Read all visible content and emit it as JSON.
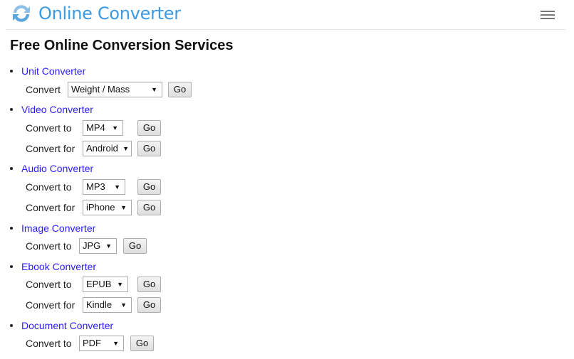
{
  "header": {
    "brand": "Online Converter",
    "menu_icon": "hamburger-icon",
    "logo_icon": "refresh-arrows-icon"
  },
  "page_title": "Free Online Conversion Services",
  "colors": {
    "brand": "#3b9ae1",
    "link": "#2a1cff"
  },
  "services": [
    {
      "label": "Unit Converter",
      "rows": [
        {
          "label": "Convert",
          "value": "Weight / Mass",
          "button": "Go"
        }
      ]
    },
    {
      "label": "Video Converter",
      "rows": [
        {
          "label": "Convert to",
          "value": "MP4",
          "button": "Go"
        },
        {
          "label": "Convert for",
          "value": "Android",
          "button": "Go"
        }
      ]
    },
    {
      "label": "Audio Converter",
      "rows": [
        {
          "label": "Convert to",
          "value": "MP3",
          "button": "Go"
        },
        {
          "label": "Convert for",
          "value": "iPhone",
          "button": "Go"
        }
      ]
    },
    {
      "label": "Image Converter",
      "rows": [
        {
          "label": "Convert to",
          "value": "JPG",
          "button": "Go"
        }
      ]
    },
    {
      "label": "Ebook Converter",
      "rows": [
        {
          "label": "Convert to",
          "value": "EPUB",
          "button": "Go"
        },
        {
          "label": "Convert for",
          "value": "Kindle",
          "button": "Go"
        }
      ]
    },
    {
      "label": "Document Converter",
      "rows": [
        {
          "label": "Convert to",
          "value": "PDF",
          "button": "Go"
        }
      ]
    }
  ]
}
